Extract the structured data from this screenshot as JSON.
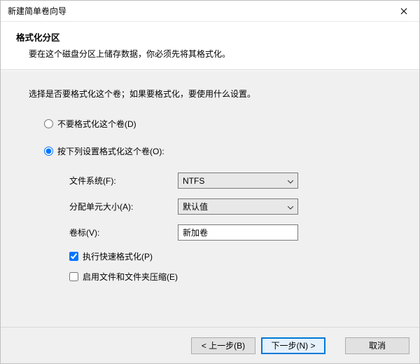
{
  "window": {
    "title": "新建简单卷向导"
  },
  "header": {
    "title": "格式化分区",
    "subtitle": "要在这个磁盘分区上储存数据，你必须先将其格式化。"
  },
  "content": {
    "instruction": "选择是否要格式化这个卷；如果要格式化，要使用什么设置。",
    "radio_noformat": "不要格式化这个卷(D)",
    "radio_format": "按下列设置格式化这个卷(O):",
    "filesystem_label": "文件系统(F):",
    "filesystem_value": "NTFS",
    "alloc_label": "分配单元大小(A):",
    "alloc_value": "默认值",
    "volume_label_label": "卷标(V):",
    "volume_label_value": "新加卷",
    "quick_format": "执行快速格式化(P)",
    "compress": "启用文件和文件夹压缩(E)"
  },
  "footer": {
    "back": "< 上一步(B)",
    "next": "下一步(N) >",
    "cancel": "取消"
  }
}
